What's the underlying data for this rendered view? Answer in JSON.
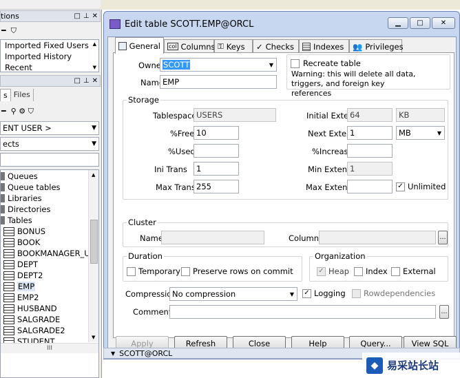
{
  "left_panel": {
    "top_title": "tions",
    "history_items": [
      "Imported Fixed Users",
      "Imported History",
      "Recent"
    ],
    "tabs": [
      "s",
      "Files"
    ],
    "user_dropdown": "ENT USER >",
    "objects_dropdown": "ects",
    "categories": [
      "Queues",
      "Queue tables",
      "Libraries",
      "Directories",
      "Tables"
    ],
    "tables": [
      "BONUS",
      "BOOK",
      "BOOKMANAGER_U",
      "DEPT",
      "DEPT2",
      "EMP",
      "EMP2",
      "HUSBAND",
      "SALGRADE",
      "SALGRADE2",
      "STUDENT"
    ],
    "selected_table": "EMP",
    "scroll_grip": "III"
  },
  "dialog": {
    "title": "Edit table SCOTT.EMP@ORCL",
    "tabs": [
      "General",
      "Columns",
      "Keys",
      "Checks",
      "Indexes",
      "Privileges"
    ],
    "owner_label": "Owner",
    "owner_value": "SCOTT",
    "name_label": "Name",
    "name_value": "EMP",
    "recreate_label": "Recreate table",
    "warning": "Warning: this will delete all data, triggers, and foreign key references",
    "storage": {
      "title": "Storage",
      "tablespace_label": "Tablespace",
      "tablespace": "USERS",
      "initial_extent_label": "Initial Extent",
      "initial_extent": "64",
      "initial_unit": "KB",
      "free_label": "%Free",
      "free": "10",
      "next_extent_label": "Next Extent",
      "next_extent": "1",
      "next_unit": "MB",
      "used_label": "%Used",
      "used": "",
      "increase_label": "%Increase",
      "increase": "",
      "initrans_label": "Ini Trans",
      "initrans": "1",
      "min_extents_label": "Min Extents",
      "min_extents": "1",
      "maxtrans_label": "Max Trans",
      "maxtrans": "255",
      "max_extents_label": "Max Extents",
      "max_extents": "",
      "unlimited_label": "Unlimited",
      "unlimited_checked": true
    },
    "cluster": {
      "title": "Cluster",
      "name_label": "Name",
      "columns_label": "Columns"
    },
    "duration": {
      "title": "Duration",
      "temporary": "Temporary",
      "preserve": "Preserve rows on commit"
    },
    "organization": {
      "title": "Organization",
      "heap": "Heap",
      "index": "Index",
      "external": "External"
    },
    "compression_label": "Compression",
    "compression_value": "No compression",
    "logging_label": "Logging",
    "rowdep_label": "Rowdependencies",
    "comments_label": "Comments",
    "buttons": [
      "Apply",
      "Refresh",
      "Close",
      "Help",
      "Query...",
      "View SQL"
    ],
    "status_connection": "SCOTT@ORCL"
  },
  "watermark_text": "易采站长站"
}
